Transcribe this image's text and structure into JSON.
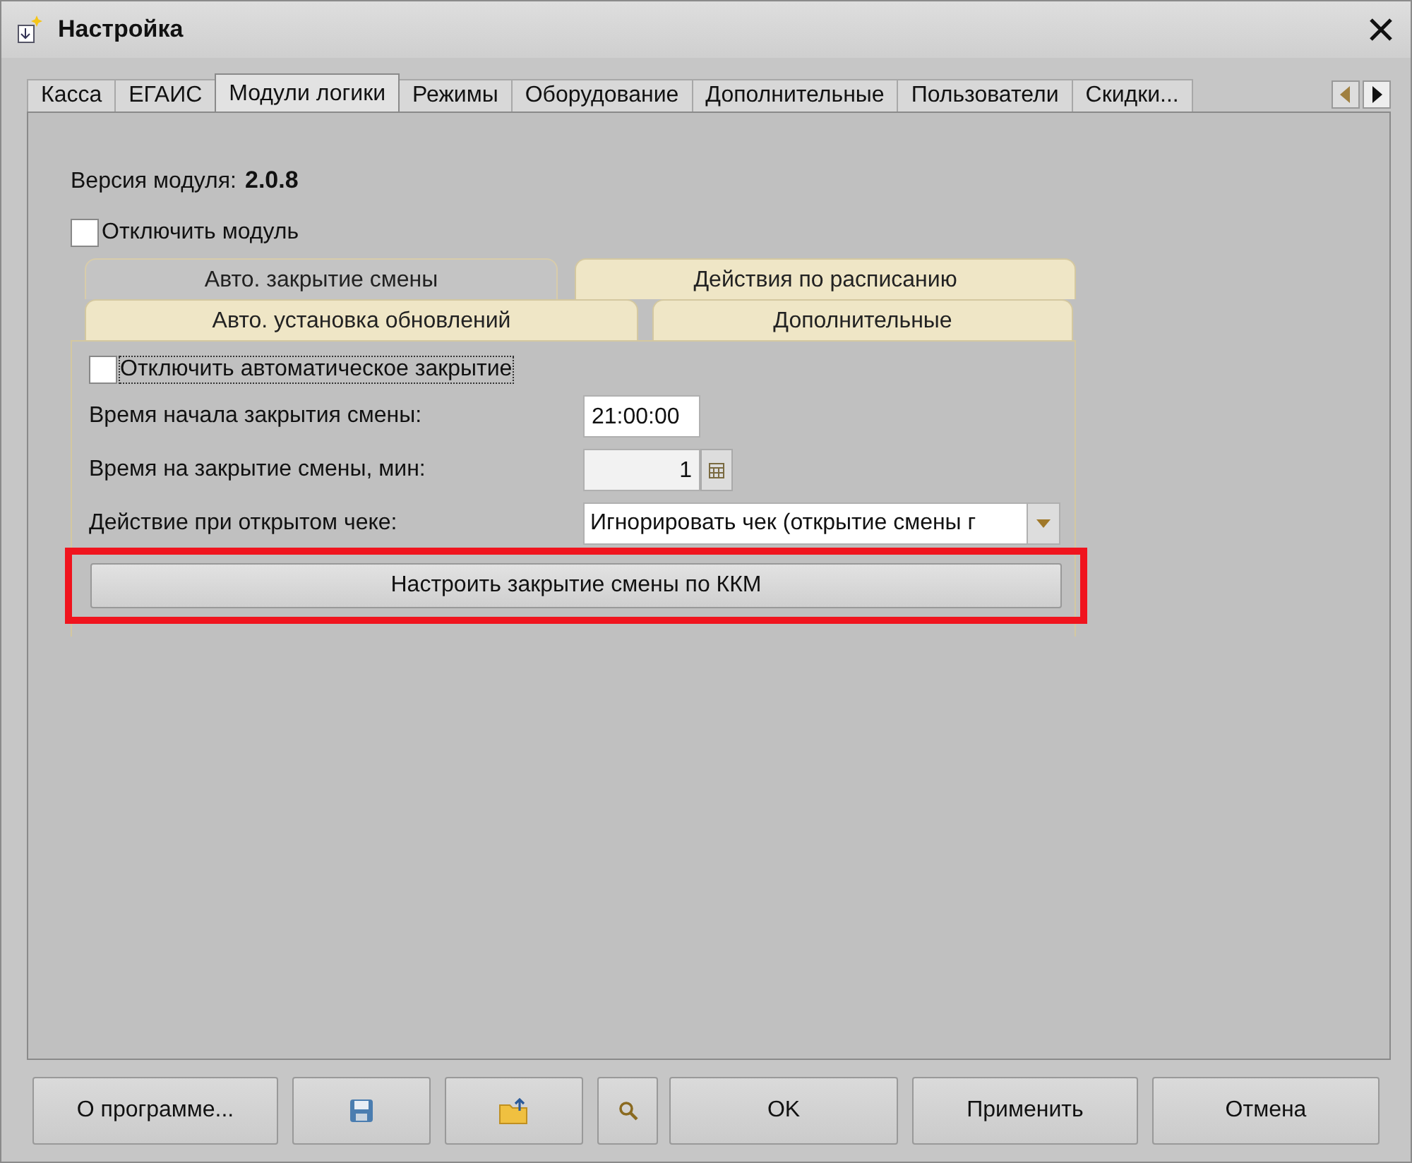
{
  "window": {
    "title": "Настройка"
  },
  "tabs": [
    {
      "label": "Касса",
      "selected": false
    },
    {
      "label": "ЕГАИС",
      "selected": false
    },
    {
      "label": "Модули логики",
      "selected": true
    },
    {
      "label": "Режимы",
      "selected": false
    },
    {
      "label": "Оборудование",
      "selected": false
    },
    {
      "label": "Дополнительные",
      "selected": false
    },
    {
      "label": "Пользователи",
      "selected": false
    },
    {
      "label": "Скидки...",
      "selected": false
    }
  ],
  "module": {
    "version_label": "Версия модуля:",
    "version": "2.0.8",
    "disable": {
      "label": "Отключить модуль",
      "checked": false
    }
  },
  "subtabs": [
    [
      {
        "label": "Авто. закрытие смены",
        "selected": true
      },
      {
        "label": "Действия по расписанию",
        "selected": false
      }
    ],
    [
      {
        "label": "Авто. установка обновлений",
        "selected": false
      },
      {
        "label": "Дополнительные",
        "selected": false
      }
    ]
  ],
  "form": {
    "disable_auto": {
      "label": "Отключить автоматическое закрытие",
      "checked": false
    },
    "fields": [
      {
        "kind": "text",
        "label": "Время начала закрытия смены:",
        "value": "21:00:00"
      },
      {
        "kind": "number",
        "label": "Время на закрытие смены, мин:",
        "value": "1"
      },
      {
        "kind": "select",
        "label": "Действие при открытом чеке:",
        "value": "Игнорировать чек (открытие смены г"
      }
    ],
    "action": {
      "label": "Настроить закрытие смены по ККМ",
      "highlighted": true
    }
  },
  "buttons": [
    {
      "kind": "text",
      "label": "О программе..."
    },
    {
      "kind": "save"
    },
    {
      "kind": "folder"
    },
    {
      "kind": "search"
    },
    {
      "kind": "text",
      "label": "OK"
    },
    {
      "kind": "text",
      "label": "Применить"
    },
    {
      "kind": "text",
      "label": "Отмена"
    }
  ]
}
